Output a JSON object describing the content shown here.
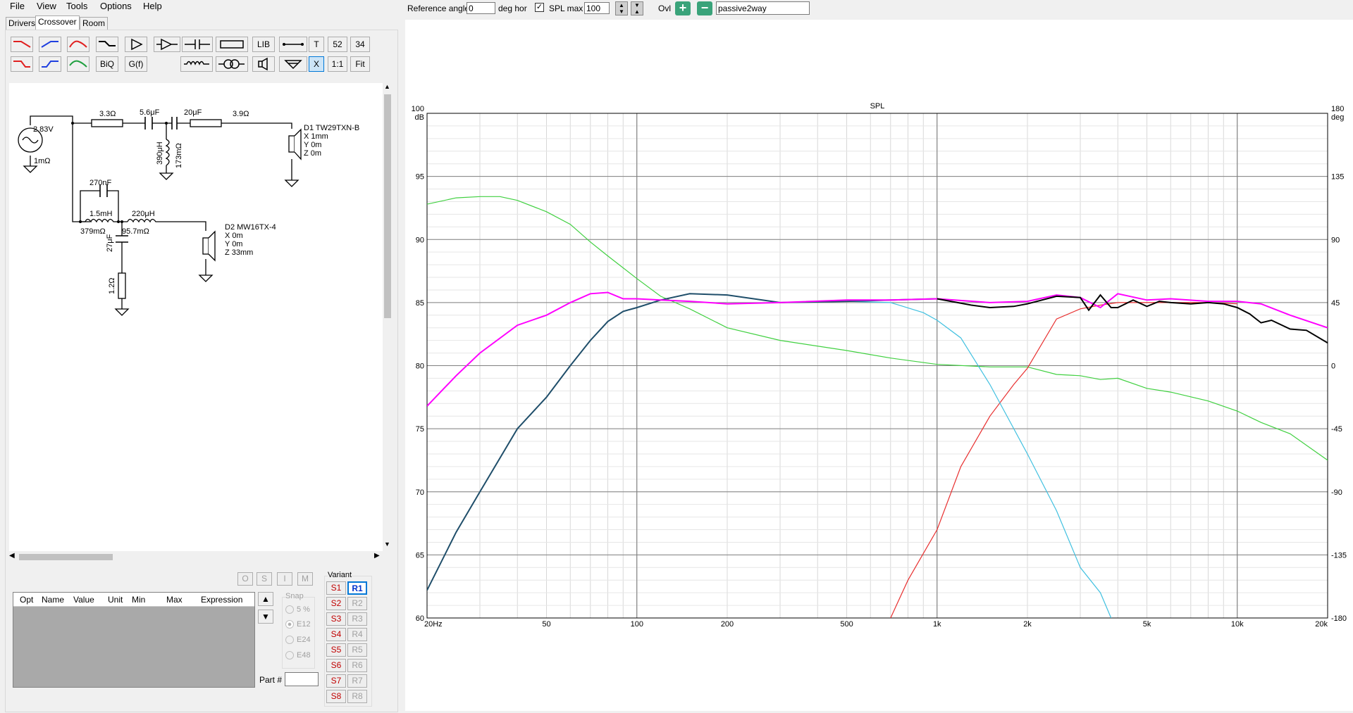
{
  "menu": [
    "File",
    "View",
    "Tools",
    "Options",
    "Help"
  ],
  "top": {
    "ref_angle_label": "Reference angle",
    "ref_angle_value": "0",
    "deg_hor_label": "deg hor",
    "spl_max_label": "SPL max",
    "spl_max_value": "100",
    "ovl_label": "Ovl",
    "ovl_name": "passive2way"
  },
  "tabs": [
    "Drivers",
    "Crossover",
    "Room"
  ],
  "toolbar": {
    "lib": "LIB",
    "t": "T",
    "n52": "52",
    "n34": "34",
    "biq": "BiQ",
    "gf": "G(f)",
    "x": "X",
    "one": "1:1",
    "fit": "Fit"
  },
  "schematic": {
    "source_v": "2.83V",
    "source_r": "1mΩ",
    "r1": "3.3Ω",
    "c1": "5.6μF",
    "c2": "20μF",
    "r2": "3.9Ω",
    "l_tw": "390μH",
    "l_tw_r": "173mΩ",
    "d1": "D1 TW29TXN-B",
    "d1x": "X 1mm",
    "d1y": "Y 0m",
    "d1z": "Z 0m",
    "c3": "270nF",
    "l1": "1.5mH",
    "l1_r": "379mΩ",
    "l2": "220μH",
    "l2_r": "95.7mΩ",
    "c4": "27μF",
    "r3": "1.2Ω",
    "d2": "D2 MW16TX-4",
    "d2x": "X 0m",
    "d2y": "Y 0m",
    "d2z": "Z 33mm"
  },
  "opt_buttons": [
    "O",
    "S",
    "I",
    "M"
  ],
  "table_headers": [
    "Opt",
    "Name",
    "Value",
    "Unit",
    "Min",
    "Max",
    "Expression"
  ],
  "snap": {
    "label": "Snap",
    "options": [
      "5 %",
      "E12",
      "E24",
      "E48"
    ],
    "selected": "E12"
  },
  "part_label": "Part #",
  "variant": {
    "label": "Variant",
    "s": [
      "S1",
      "S2",
      "S3",
      "S4",
      "S5",
      "S6",
      "S7",
      "S8"
    ],
    "r": [
      "R1",
      "R2",
      "R3",
      "R4",
      "R5",
      "R6",
      "R7",
      "R8"
    ],
    "active": "R1"
  },
  "chart_data": {
    "type": "line",
    "title": "SPL",
    "xscale": "log",
    "xlim": [
      20,
      20000
    ],
    "ylim": [
      60,
      100
    ],
    "y2lim": [
      -180,
      180
    ],
    "ylabel": "dB",
    "y2label": "deg",
    "x_ticks": [
      "20Hz",
      "50",
      "100",
      "200",
      "500",
      "1k",
      "2k",
      "5k",
      "10k",
      "20k"
    ],
    "y_ticks": [
      "100",
      "95",
      "90",
      "85",
      "80",
      "75",
      "70",
      "65",
      "60"
    ],
    "y2_ticks": [
      "180",
      "135",
      "90",
      "45",
      "0",
      "-45",
      "-90",
      "-135",
      "-180"
    ],
    "grid": true,
    "series": [
      {
        "color": "#ff00ff",
        "x": [
          20,
          25,
          30,
          40,
          50,
          60,
          70,
          80,
          90,
          100,
          120,
          150,
          200,
          300,
          500,
          700,
          1000,
          1500,
          2000,
          2500,
          3000,
          3500,
          4000,
          5000,
          6000,
          8000,
          10000,
          12000,
          15000,
          20000
        ],
        "y": [
          76.8,
          79.2,
          81.0,
          83.2,
          84.0,
          85.0,
          85.7,
          85.8,
          85.3,
          85.3,
          85.2,
          85.1,
          84.9,
          85.0,
          85.2,
          85.2,
          85.3,
          85.0,
          85.1,
          85.6,
          85.4,
          84.6,
          85.7,
          85.2,
          85.3,
          85.1,
          85.1,
          84.9,
          84.0,
          83.0
        ]
      },
      {
        "color": "#000000",
        "x": [
          1000,
          1300,
          1500,
          1800,
          2000,
          2500,
          3000,
          3200,
          3500,
          3800,
          4000,
          4500,
          5000,
          5500,
          6000,
          7000,
          8000,
          9000,
          10000,
          11000,
          12000,
          13000,
          15000,
          17000,
          20000
        ],
        "y": [
          85.3,
          84.8,
          84.6,
          84.7,
          84.9,
          85.5,
          85.4,
          84.4,
          85.6,
          84.6,
          84.6,
          85.2,
          84.7,
          85.1,
          85.0,
          84.9,
          85.0,
          84.9,
          84.6,
          84.1,
          83.4,
          83.6,
          82.9,
          82.8,
          81.8
        ]
      },
      {
        "color": "#1f4e6a",
        "x": [
          20,
          25,
          30,
          40,
          50,
          60,
          70,
          80,
          90,
          100,
          120,
          150,
          200,
          300,
          500,
          700,
          1000
        ],
        "y": [
          62.2,
          66.8,
          70.0,
          75.0,
          77.5,
          80.0,
          82.0,
          83.5,
          84.3,
          84.6,
          85.2,
          85.7,
          85.6,
          85.0,
          85.1,
          85.2,
          85.3
        ]
      },
      {
        "color": "#40d040",
        "x": [
          20,
          25,
          30,
          35,
          40,
          50,
          60,
          70,
          80,
          100,
          120,
          150,
          200,
          300,
          500,
          700,
          1000,
          1500,
          2000,
          2500,
          3000,
          3500,
          4000,
          5000,
          6000,
          8000,
          10000,
          12000,
          15000,
          20000
        ],
        "y": [
          92.8,
          93.3,
          93.4,
          93.4,
          93.1,
          92.2,
          91.2,
          89.8,
          88.7,
          86.9,
          85.5,
          84.5,
          83.0,
          82.0,
          81.2,
          80.6,
          80.1,
          79.9,
          79.9,
          79.3,
          79.2,
          78.9,
          79.0,
          78.2,
          77.9,
          77.2,
          76.4,
          75.5,
          74.6,
          72.5
        ]
      },
      {
        "color": "#40c0e0",
        "x": [
          100,
          120,
          150,
          200,
          300,
          500,
          700,
          900,
          1000,
          1200,
          1500,
          2000,
          2500,
          3000,
          3500,
          3800
        ],
        "y": [
          84.6,
          85.2,
          85.7,
          85.6,
          85.0,
          85.1,
          85.0,
          84.2,
          83.6,
          82.2,
          78.5,
          73.0,
          68.5,
          64.0,
          62.0,
          60.0
        ]
      },
      {
        "color": "#e83030",
        "x": [
          700,
          800,
          1000,
          1200,
          1500,
          1800,
          2000,
          2500,
          3000,
          3500,
          4000,
          5000,
          6000,
          8000,
          10000
        ],
        "y": [
          60.0,
          63.0,
          67.0,
          72.0,
          76.0,
          78.5,
          79.8,
          83.7,
          84.5,
          84.8,
          85.0,
          85.0,
          85.0,
          85.0,
          84.9
        ]
      }
    ]
  }
}
